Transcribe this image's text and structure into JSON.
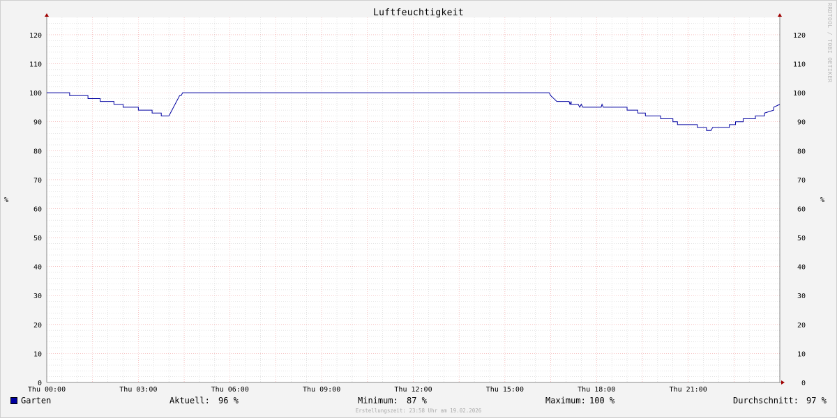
{
  "title": "Luftfeuchtigkeit",
  "watermark": "RRDTOOL / TOBI OETIKER",
  "footer": "Erstellungszeit: 23:58 Uhr am 19.02.2026",
  "colors": {
    "line": "#0000a0",
    "major_grid": "#f2a0a0",
    "minor_grid": "#c8c8c8",
    "axis": "#888888",
    "arrow": "#a00000",
    "background": "#f3f3f3",
    "plot_background": "#ffffff"
  },
  "legend": {
    "series_label": "Garten",
    "current_label": "Aktuell:",
    "current_value": "96 %",
    "min_label": "Minimum:",
    "min_value": "87 %",
    "max_label": "Maximum:",
    "max_value": "100 %",
    "avg_label": "Durchschnitt:",
    "avg_value": "97 %"
  },
  "chart_data": {
    "type": "line",
    "title": "Luftfeuchtigkeit",
    "ylabel": "%",
    "ylim": [
      0,
      126
    ],
    "y_ticks": [
      0,
      10,
      20,
      30,
      40,
      50,
      60,
      70,
      80,
      90,
      100,
      110,
      120
    ],
    "xlim_hours": [
      0,
      24
    ],
    "x_tick_hours": [
      0,
      3,
      6,
      9,
      12,
      15,
      18,
      21
    ],
    "x_tick_labels": [
      "Thu 00:00",
      "Thu 03:00",
      "Thu 06:00",
      "Thu 09:00",
      "Thu 12:00",
      "Thu 15:00",
      "Thu 18:00",
      "Thu 21:00"
    ],
    "grid": true,
    "series": [
      {
        "name": "Garten",
        "color": "#0000a0",
        "x_hours": [
          0.0,
          0.75,
          0.75,
          1.35,
          1.35,
          1.75,
          1.75,
          2.2,
          2.2,
          2.5,
          2.5,
          3.0,
          3.0,
          3.45,
          3.45,
          3.75,
          3.75,
          4.0,
          4.05,
          4.1,
          4.15,
          4.2,
          4.25,
          4.3,
          4.35,
          4.4,
          4.45,
          4.5,
          16.45,
          16.5,
          16.6,
          16.7,
          16.7,
          17.1,
          17.13,
          17.17,
          17.17,
          17.4,
          17.45,
          17.5,
          17.55,
          17.6,
          18.15,
          18.18,
          18.22,
          19.0,
          19.0,
          19.35,
          19.35,
          19.6,
          19.6,
          20.1,
          20.1,
          20.5,
          20.5,
          20.65,
          20.65,
          21.3,
          21.3,
          21.6,
          21.6,
          21.75,
          21.8,
          21.85,
          22.35,
          22.35,
          22.55,
          22.55,
          22.8,
          22.8,
          23.2,
          23.2,
          23.5,
          23.5,
          23.8,
          23.8,
          24.0
        ],
        "values": [
          100,
          100,
          99,
          99,
          98,
          98,
          97,
          97,
          96,
          96,
          95,
          95,
          94,
          94,
          93,
          93,
          92,
          92,
          93,
          94,
          95,
          96,
          97,
          98,
          99,
          99,
          100,
          100,
          100,
          99,
          98,
          97,
          97,
          97,
          96,
          97,
          96,
          96,
          95,
          96,
          95,
          95,
          95,
          96,
          95,
          95,
          94,
          94,
          93,
          93,
          92,
          92,
          91,
          91,
          90,
          90,
          89,
          89,
          88,
          88,
          87,
          87,
          88,
          88,
          88,
          89,
          89,
          90,
          90,
          91,
          91,
          92,
          92,
          93,
          94,
          95,
          96
        ]
      }
    ]
  }
}
